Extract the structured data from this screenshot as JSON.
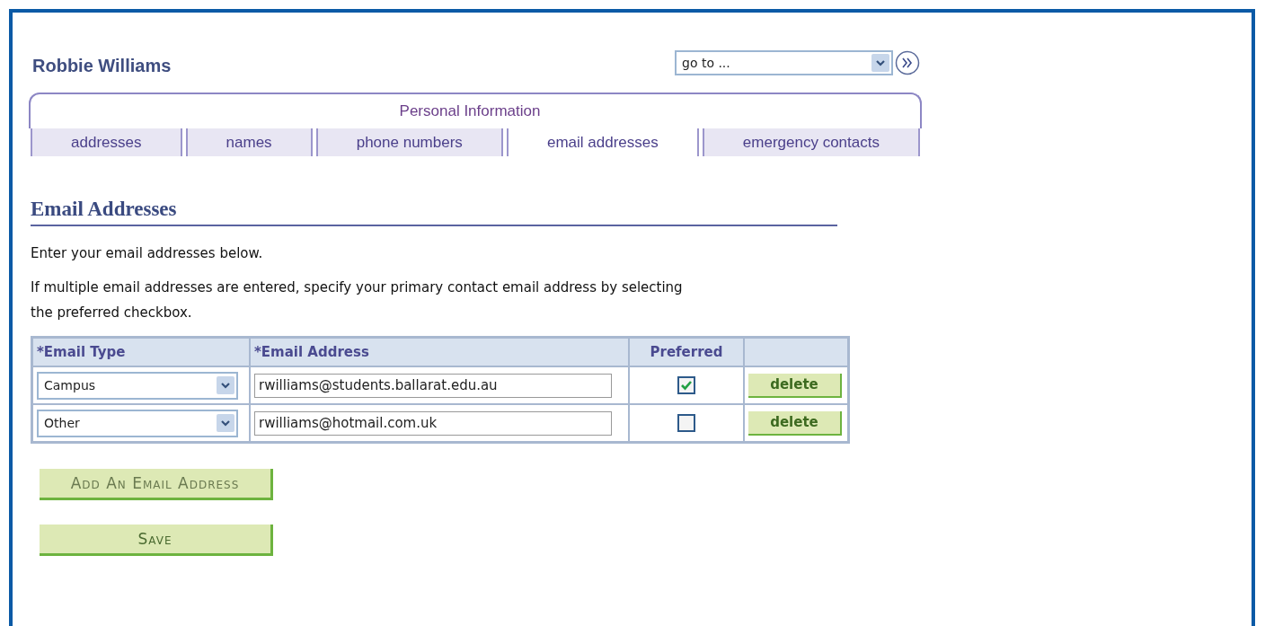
{
  "person_name": "Robbie Williams",
  "goto": {
    "value": "go to ..."
  },
  "tab_group": {
    "title": "Personal Information"
  },
  "tabs": [
    {
      "label": "addresses",
      "selected": false
    },
    {
      "label": "names",
      "selected": false
    },
    {
      "label": "phone numbers",
      "selected": false
    },
    {
      "label": "email addresses",
      "selected": true
    },
    {
      "label": "emergency contacts",
      "selected": false
    }
  ],
  "section_title": "Email Addresses",
  "paragraphs": [
    "Enter your email addresses below.",
    "If multiple email addresses are entered, specify your primary contact email address by selecting the preferred checkbox."
  ],
  "table": {
    "columns": [
      "*Email Type",
      "*Email Address",
      "Preferred"
    ],
    "rows": [
      {
        "type": "Campus",
        "address": "rwilliams@students.ballarat.edu.au",
        "preferred": true,
        "action": "delete"
      },
      {
        "type": "Other",
        "address": "rwilliams@hotmail.com.uk",
        "preferred": false,
        "action": "delete"
      }
    ]
  },
  "buttons": [
    "Add An Email Address",
    "Save"
  ]
}
